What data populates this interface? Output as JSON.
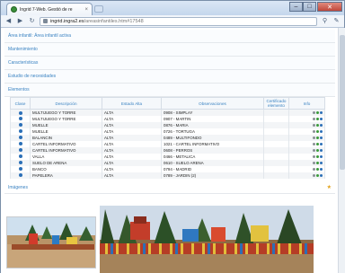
{
  "browser": {
    "tab_title": "Ingrid 7-Web. Gestió de re",
    "tab_close": "×",
    "url_host": "ingrid.ingra2.es",
    "url_path": "/areasinfantiles.htm#17548"
  },
  "sections": [
    "Área infantil: Área infantil activa",
    "Mantenimiento",
    "Características",
    "Estudio de necesidades",
    "Elementos"
  ],
  "table": {
    "headers": [
      "Clase",
      "Descripción",
      "Estado Alta",
      "Observaciones",
      "Certificado elemento",
      "Info"
    ],
    "rows": [
      {
        "desc": "MULTIJUEGO Y TORRE",
        "estado": "ALTA",
        "obs": "0908 - SIMPLAY"
      },
      {
        "desc": "MULTIJUEGO Y TORRE",
        "estado": "ALTA",
        "obs": "0907 - MARTIN"
      },
      {
        "desc": "MUELLE",
        "estado": "ALTA",
        "obs": "0876 - MARIA"
      },
      {
        "desc": "MUELLE",
        "estado": "ALTA",
        "obs": "0726 - TORTUGA"
      },
      {
        "desc": "BALANCIN",
        "estado": "ALTA",
        "obs": "0489 - MULTIFONDO"
      },
      {
        "desc": "CARTEL INFORMATIVO",
        "estado": "ALTA",
        "obs": "1021 - CARTEL INFORMATIVO"
      },
      {
        "desc": "CARTEL INFORMATIVO",
        "estado": "ALTA",
        "obs": "0608 - PERROS"
      },
      {
        "desc": "VALLA",
        "estado": "ALTA",
        "obs": "0466 - METALICA"
      },
      {
        "desc": "SUELO DE ARENA",
        "estado": "ALTA",
        "obs": "0610 - SUELO ARENA"
      },
      {
        "desc": "BANCO",
        "estado": "ALTA",
        "obs": "0794 - MADRID"
      },
      {
        "desc": "PAPELERA",
        "estado": "ALTA",
        "obs": "0789 - JARDIN (2)"
      }
    ]
  },
  "images": {
    "label": "Imágenes"
  },
  "colors": {
    "link": "#3b83c2",
    "bullet": "#2b6fb7",
    "star": "#e2a21b"
  }
}
